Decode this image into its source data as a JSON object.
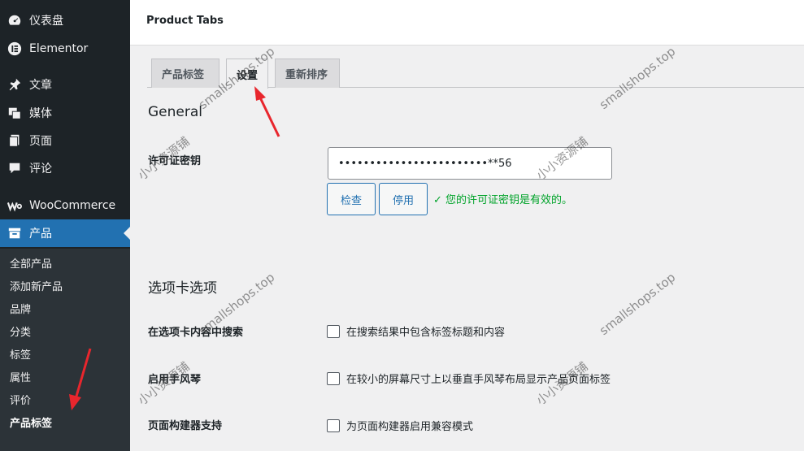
{
  "sidebar": {
    "items": [
      {
        "label": "仪表盘",
        "icon": "dashboard-icon"
      },
      {
        "label": "Elementor",
        "icon": "elementor-icon"
      },
      {
        "label": "文章",
        "icon": "pin-icon"
      },
      {
        "label": "媒体",
        "icon": "media-icon"
      },
      {
        "label": "页面",
        "icon": "pages-icon"
      },
      {
        "label": "评论",
        "icon": "comment-icon"
      },
      {
        "label": "WooCommerce",
        "icon": "woocommerce-icon"
      },
      {
        "label": "产品",
        "icon": "archive-icon"
      }
    ],
    "submenu": [
      "全部产品",
      "添加新产品",
      "品牌",
      "分类",
      "标签",
      "属性",
      "评价",
      "产品标签"
    ]
  },
  "header": {
    "title": "Product Tabs"
  },
  "tabs": [
    {
      "label": "产品标签"
    },
    {
      "label": "设置"
    },
    {
      "label": "重新排序"
    }
  ],
  "general": {
    "heading": "General",
    "license_label": "许可证密钥",
    "license_value": "••••••••••••••••••••••••**56",
    "check_button": "检查",
    "deactivate_button": "停用",
    "valid_message": "✓ 您的许可证密钥是有效的。"
  },
  "tab_options": {
    "heading": "选项卡选项",
    "rows": [
      {
        "label": "在选项卡内容中搜索",
        "checkbox_text": "在搜索结果中包含标签标题和内容"
      },
      {
        "label": "启用手风琴",
        "checkbox_text": "在较小的屏幕尺寸上以垂直手风琴布局显示产品页面标签"
      },
      {
        "label": "页面构建器支持",
        "checkbox_text": "为页面构建器启用兼容模式"
      }
    ]
  },
  "watermarks": {
    "site": "smallshops.top",
    "cn": "小小资源铺"
  },
  "colors": {
    "accent": "#2271b1",
    "sidebar": "#1d2327",
    "success": "#00a32a",
    "annotation": "#e8262d"
  }
}
